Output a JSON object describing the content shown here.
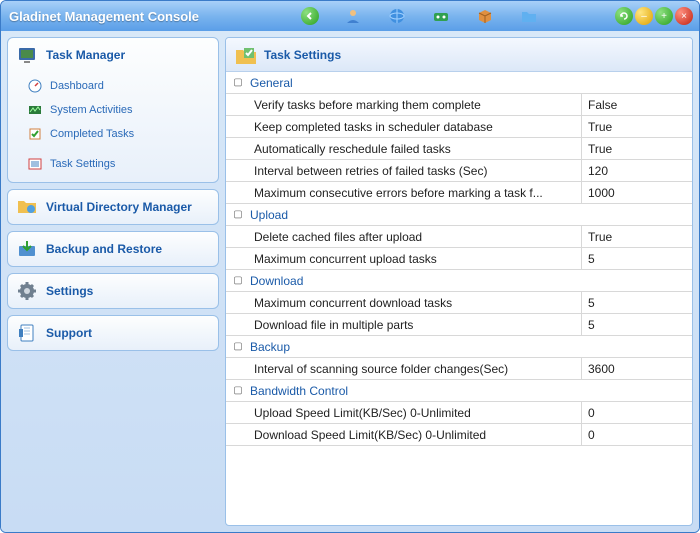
{
  "title": "Gladinet Management Console",
  "sidebar": {
    "taskManager": {
      "label": "Task Manager",
      "items": [
        {
          "label": "Dashboard"
        },
        {
          "label": "System Activities"
        },
        {
          "label": "Completed Tasks"
        },
        {
          "label": "Task Settings"
        }
      ]
    },
    "virtualDir": {
      "label": "Virtual Directory Manager"
    },
    "backup": {
      "label": "Backup and Restore"
    },
    "settings": {
      "label": "Settings"
    },
    "support": {
      "label": "Support"
    }
  },
  "panel": {
    "title": "Task Settings",
    "sections": [
      {
        "name": "General",
        "rows": [
          {
            "k": "Verify tasks before marking them complete",
            "v": "False"
          },
          {
            "k": "Keep completed tasks in scheduler database",
            "v": "True"
          },
          {
            "k": "Automatically reschedule failed tasks",
            "v": "True"
          },
          {
            "k": "Interval between retries of failed tasks (Sec)",
            "v": "120"
          },
          {
            "k": "Maximum consecutive errors before marking a task f...",
            "v": "1000"
          }
        ]
      },
      {
        "name": "Upload",
        "rows": [
          {
            "k": "Delete cached files after upload",
            "v": "True"
          },
          {
            "k": "Maximum concurrent upload tasks",
            "v": "5"
          }
        ]
      },
      {
        "name": "Download",
        "rows": [
          {
            "k": "Maximum concurrent download tasks",
            "v": "5"
          },
          {
            "k": "Download file in multiple parts",
            "v": "5"
          }
        ]
      },
      {
        "name": "Backup",
        "rows": [
          {
            "k": "Interval of scanning source folder changes(Sec)",
            "v": "3600"
          }
        ]
      },
      {
        "name": "Bandwidth Control",
        "rows": [
          {
            "k": "Upload Speed Limit(KB/Sec) 0-Unlimited",
            "v": "0"
          },
          {
            "k": "Download Speed Limit(KB/Sec) 0-Unlimited",
            "v": "0"
          }
        ]
      }
    ]
  }
}
